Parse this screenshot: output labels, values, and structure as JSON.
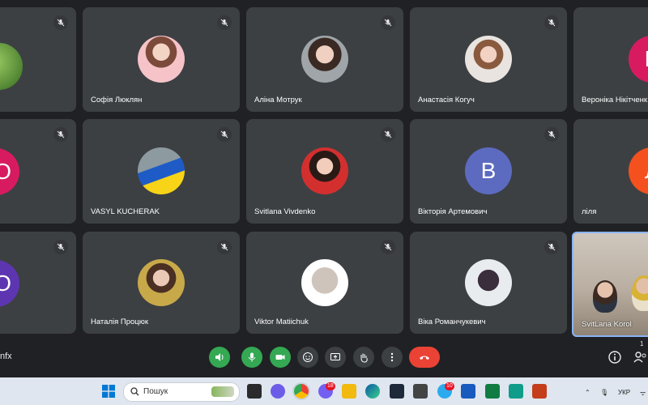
{
  "participants": [
    {
      "name": "",
      "avatar_letter": ""
    },
    {
      "name": "Софія Люклян",
      "avatar_letter": ""
    },
    {
      "name": "Аліна Мотрук",
      "avatar_letter": ""
    },
    {
      "name": "Анастасія Когуч",
      "avatar_letter": ""
    },
    {
      "name": "Вероніка Нікітченк",
      "avatar_letter": "В"
    },
    {
      "name": "",
      "avatar_letter": "О"
    },
    {
      "name": "VASYL KUCHERAK",
      "avatar_letter": ""
    },
    {
      "name": "Svitlana Vivdenko",
      "avatar_letter": ""
    },
    {
      "name": "Вікторія Артемович",
      "avatar_letter": "В"
    },
    {
      "name": "ліля",
      "avatar_letter": "Л"
    },
    {
      "name": "",
      "avatar_letter": "О"
    },
    {
      "name": "Наталія Процюк",
      "avatar_letter": ""
    },
    {
      "name": "Viktor Matiichuk",
      "avatar_letter": ""
    },
    {
      "name": "Віка Романчукевич",
      "avatar_letter": ""
    }
  ],
  "self_view": {
    "name": "SvitLana Korol"
  },
  "meeting_code_fragment": "nfx",
  "participants_count": "1",
  "taskbar": {
    "search_placeholder": "Пошук",
    "viber_badge": "18",
    "telegram_badge": "10",
    "language": "УКР"
  },
  "colors": {
    "avatar_pink": "#d81b60",
    "avatar_blue": "#5c6bc0",
    "avatar_orange": "#f4511e",
    "avatar_purple": "#5e35b1",
    "end_call": "#ea4335",
    "active_control": "#34a853"
  },
  "icons": {
    "controls": [
      "volume-icon",
      "mic-icon",
      "camera-icon",
      "emoji-icon",
      "present-icon",
      "raise-hand-icon",
      "more-icon",
      "end-call-icon"
    ],
    "right": [
      "info-icon",
      "people-icon"
    ]
  }
}
